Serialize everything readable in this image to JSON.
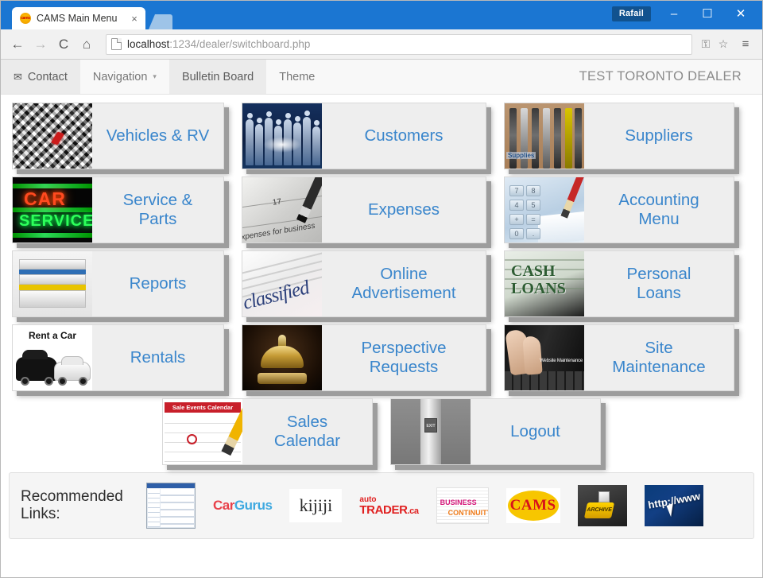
{
  "browser": {
    "tab": {
      "title": "CAMS Main Menu",
      "favicon": "cams-favicon",
      "close": "×"
    },
    "new_tab_label": "+",
    "user_chip": "Rafail",
    "window_controls": {
      "minimize": "–",
      "maximize": "☐",
      "close": "✕"
    },
    "toolbar": {
      "back": "←",
      "forward": "→",
      "reload": "C",
      "home": "⌂",
      "url_host": "localhost",
      "url_path": ":1234/dealer/switchboard.php",
      "key_icon": "⚿",
      "star_icon": "☆",
      "menu_icon": "≡"
    }
  },
  "app": {
    "nav": [
      {
        "label": "Contact",
        "icon": "envelope-icon",
        "state": "active"
      },
      {
        "label": "Navigation",
        "icon": "caret-down-icon",
        "state": "normal",
        "caret": "▾"
      },
      {
        "label": "Bulletin Board",
        "icon": "",
        "state": "active"
      },
      {
        "label": "Theme",
        "icon": "",
        "state": "normal"
      }
    ],
    "dealer_name": "TEST TORONTO DEALER"
  },
  "tiles": {
    "rows": [
      [
        {
          "label": "Vehicles & RV",
          "art": "diamond-plate-thumb"
        },
        {
          "label": "Customers",
          "art": "people-silhouettes-thumb"
        },
        {
          "label": "Suppliers",
          "art": "tools-thumb"
        }
      ],
      [
        {
          "label": "Service &\nParts",
          "art": "neon-car-service-thumb"
        },
        {
          "label": "Expenses",
          "art": "pen-on-paper-thumb"
        },
        {
          "label": "Accounting\nMenu",
          "art": "calculator-thumb"
        }
      ],
      [
        {
          "label": "Reports",
          "art": "book-stack-thumb"
        },
        {
          "label": "Online\nAdvertisement",
          "art": "classifieds-thumb"
        },
        {
          "label": "Personal\nLoans",
          "art": "cash-loans-thumb"
        }
      ],
      [
        {
          "label": "Rentals",
          "art": "rent-a-car-thumb"
        },
        {
          "label": "Perspective\nRequests",
          "art": "service-bell-thumb"
        },
        {
          "label": "Site\nMaintenance",
          "art": "hands-typing-thumb"
        }
      ],
      [
        {
          "label": "Sales\nCalendar",
          "art": "sale-events-calendar-thumb"
        },
        {
          "label": "Logout",
          "art": "exit-turnstile-thumb"
        }
      ]
    ],
    "thumb_text": {
      "suppliers": "Supplies",
      "service_line1": "CAR",
      "service_line2": "SERVICE",
      "expenses_caption": "xpenses for business",
      "expenses_number": "17",
      "classified_word": "classified",
      "cash_line1": "CASH",
      "cash_line2": "LOANS",
      "rent_header": "Rent a Car",
      "site_caption": "Website Maintenance",
      "calendar_header": "Sale Events Calendar",
      "logout_sign": "EXIT"
    }
  },
  "footer": {
    "label": "Recommended\nLinks:",
    "links": [
      {
        "name": "cams-screenshot-link",
        "text": ""
      },
      {
        "name": "cargurus-link",
        "text_a": "Car",
        "text_b": "Gurus"
      },
      {
        "name": "kijiji-link",
        "text": "kijiji"
      },
      {
        "name": "autotrader-link",
        "text_a": "auto",
        "text_b": "TRADER",
        "text_c": ".ca"
      },
      {
        "name": "business-continuity-link",
        "text_a": "BUSINESS",
        "text_b": "CONTINUITY"
      },
      {
        "name": "cams-logo-link",
        "text": "CAMS"
      },
      {
        "name": "archive-link",
        "text": "ARCHIVE"
      },
      {
        "name": "http-www-link",
        "text": "http://www"
      }
    ]
  },
  "colors": {
    "titlebar": "#1b76d2",
    "tile_text": "#3a86cc",
    "tile_bg": "#eeeeee",
    "dealer_text": "#8b8b8b"
  }
}
